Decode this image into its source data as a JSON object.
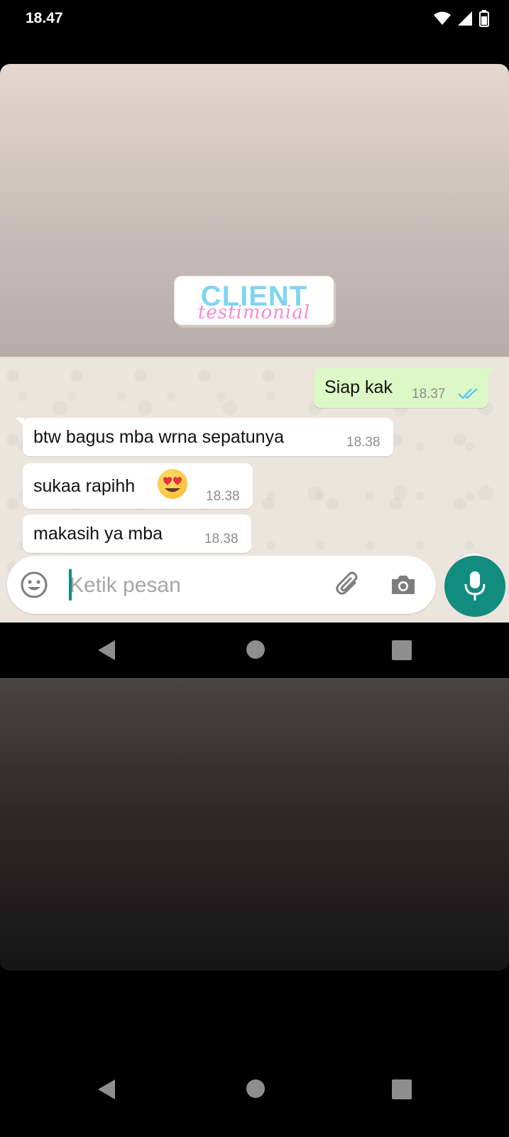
{
  "status_bar": {
    "time": "18.47",
    "wifi_icon": "wifi-icon",
    "signal_icon": "signal-icon",
    "battery_icon": "battery-icon"
  },
  "overlay": {
    "title": "CLIENT",
    "subtitle": "testimonial"
  },
  "messages": [
    {
      "direction": "outgoing",
      "text": "Siap kak",
      "time": "18.37",
      "status": "read"
    },
    {
      "direction": "incoming",
      "text": "btw bagus mba wrna sepatunya",
      "time": "18.38"
    },
    {
      "direction": "incoming",
      "text": "sukaa rapihh",
      "time": "18.38",
      "emoji": "heart-eyes"
    },
    {
      "direction": "incoming",
      "text": "makasih ya mba",
      "time": "18.38"
    }
  ],
  "composer": {
    "placeholder": "Ketik pesan",
    "value": ""
  },
  "colors": {
    "accent": "#128c7e",
    "outgoing_bubble": "#dcf8c6",
    "incoming_bubble": "#ffffff",
    "read_ticks": "#4fc3f7",
    "chat_bg": "#ece5dd"
  }
}
